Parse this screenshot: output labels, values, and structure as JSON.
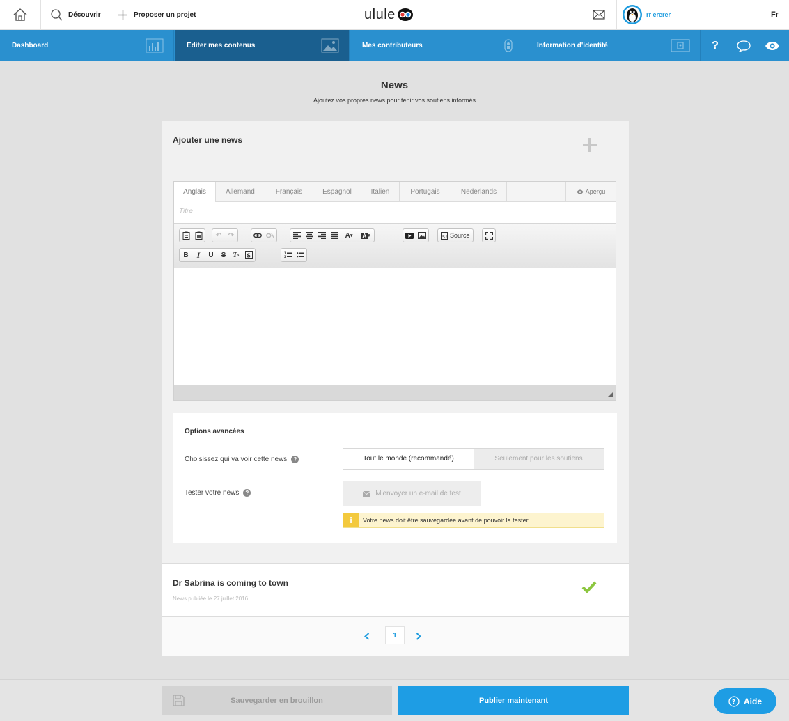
{
  "topbar": {
    "discover_label": "Découvrir",
    "propose_label": "Proposer un projet",
    "logo_text": "ulule",
    "user_name": "rr ererer",
    "language": "Fr"
  },
  "bluenav": {
    "tabs": [
      {
        "label": "Dashboard",
        "icon": "bar-chart-icon"
      },
      {
        "label": "Editer mes contenus",
        "icon": "image-icon",
        "active": true
      },
      {
        "label": "Mes contributeurs",
        "icon": "user-icon"
      },
      {
        "label": "Information d'identité",
        "icon": "id-card-icon"
      }
    ],
    "help_icon": "?",
    "accent": "#2a90cf",
    "active_color": "#1a5f8f"
  },
  "header": {
    "title": "News",
    "subtitle": "Ajoutez vos propres news pour tenir vos soutiens informés"
  },
  "add_news": {
    "title": "Ajouter une news",
    "language_tabs": [
      "Anglais",
      "Allemand",
      "Français",
      "Espagnol",
      "Italien",
      "Portugais",
      "Nederlands"
    ],
    "active_language": "Anglais",
    "preview_label": "Aperçu",
    "title_placeholder": "Titre",
    "toolbar": {
      "source_label": "Source"
    }
  },
  "options": {
    "title": "Options avancées",
    "visibility_label": "Choisissez qui va voir cette news",
    "visibility_options": [
      "Tout le monde (recommandé)",
      "Seulement pour les soutiens"
    ],
    "visibility_selected": "Tout le monde (recommandé)",
    "test_label": "Tester votre news",
    "test_button": "M'envoyer un e-mail de test",
    "warning": "Votre news doit être sauvegardée avant de pouvoir la tester"
  },
  "news_list": [
    {
      "title": "Dr Sabrina is coming to town",
      "date": "News publiée le 27 juillet 2016",
      "status": "published"
    }
  ],
  "pagination": {
    "current_page": "1"
  },
  "footer": {
    "draft_label": "Sauvegarder en brouillon",
    "publish_label": "Publier maintenant",
    "help_label": "Aide"
  },
  "colors": {
    "primary": "#1e9de4",
    "success": "#8cc63f",
    "warning_bg": "#fdf4cf"
  }
}
